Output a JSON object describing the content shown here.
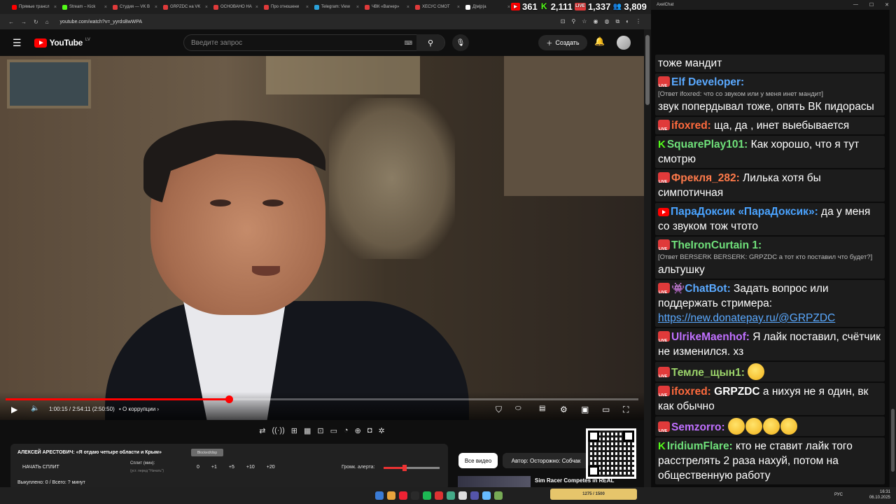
{
  "browser": {
    "tabs": [
      {
        "label": "Прямые трансл",
        "color": "#ff0000"
      },
      {
        "label": "Stream – Kick",
        "color": "#53fc18"
      },
      {
        "label": "Студия — VK В",
        "color": "#e03a3a"
      },
      {
        "label": "GRPZDC на VK",
        "color": "#e03a3a"
      },
      {
        "label": "ОСНОВАНО НА",
        "color": "#e03a3a"
      },
      {
        "label": "Про отношени",
        "color": "#e03a3a"
      },
      {
        "label": "Telegram: View",
        "color": "#2aa1da"
      },
      {
        "label": "ЧВК «Вагнер»",
        "color": "#e03a3a"
      },
      {
        "label": "ХЕСУС СМОТ",
        "color": "#e03a3a"
      },
      {
        "label": "Д|м|р|а",
        "color": "#ffffff"
      }
    ],
    "url": "youtube.com/watch?v=_yyrdsBwWPA"
  },
  "overlay": {
    "yt_count": "361",
    "kick_count": "2,111",
    "vk_count": "1,337",
    "total": "3,809"
  },
  "youtube": {
    "logo": "YouTube",
    "country": "LV",
    "search_placeholder": "Введите запрос",
    "create_label": "Создать",
    "player": {
      "current": "1:00:15",
      "duration": "2:54:11",
      "remaining": "(2:50:50)",
      "chapter": "О коррупции",
      "progress": 0.353
    },
    "panel": {
      "title": "АЛЕКСЕЙ АРЕСТОВИЧ: «Я отдаю четыре области и Крым»",
      "badge": "Blocked/disp",
      "start_split": "НАЧАТЬ СПЛИТ",
      "split_label": "Сплит (мин):",
      "split_sub": "(уст. перед \"Начать\")",
      "split_values": [
        "0",
        "+1",
        "+5",
        "+10",
        "+20"
      ],
      "alert_label": "Громк. алерта:",
      "alert_level": 0.38,
      "bought": "Выкуплено: 0 / Всего: ? минут"
    },
    "chips": [
      "Все видео",
      "Автор: Осторожно: Собчак"
    ],
    "rec_title": "Sim Racer Competes in REAL"
  },
  "chat_app": {
    "title": "AxelChat"
  },
  "chat": [
    {
      "badge": "none",
      "nick": "",
      "color": "#fff",
      "text": "тоже мандит"
    },
    {
      "badge": "live",
      "nick": "Elf Developer:",
      "color": "#5aa9ff",
      "reply": "[Ответ ifoxred: что со звуком или у меня инет мандит]",
      "text": "звук попердывал тоже, опять ВК пидорасы"
    },
    {
      "badge": "live",
      "nick": "ifoxred:",
      "color": "#ff6a3d",
      "text": "ща, да , инет выебывается"
    },
    {
      "badge": "kick",
      "nick": "SquarePlay101:",
      "color": "#6fe07a",
      "text": "Как хорошо, что я тут смотрю"
    },
    {
      "badge": "live",
      "nick": "Фрекля_282:",
      "color": "#ff7a4a",
      "text": "Лилька хотя бы симпотичная"
    },
    {
      "badge": "yt",
      "nick": "ПараДоксик «ПараДоксик»:",
      "color": "#4aa3ff",
      "text": "да у меня со звуком тож чтото"
    },
    {
      "badge": "live",
      "nick": "TheIronCurtain 1:",
      "color": "#6fe07a",
      "reply": "[Ответ BERSERK BERSERK: GRPZDC а тот кто поставил что будет?]",
      "text": "альтушку"
    },
    {
      "badge": "live",
      "nick": "👾ChatBot:",
      "color": "#5aa9ff",
      "text": "Задать вопрос или поддержать стримера:",
      "link": "https://new.donatepay.ru/@GRPZDC"
    },
    {
      "badge": "live",
      "nick": "UlrikeMaenhof:",
      "color": "#c070ff",
      "text": "Я лайк поставил, счётчик не изменился. хз"
    },
    {
      "badge": "live",
      "nick": "Темле_щын1:",
      "color": "#9bd36a",
      "text": "",
      "emojis": 1
    },
    {
      "badge": "live",
      "nick": "ifoxred:",
      "color": "#ff6a3d",
      "bold": "GRPZDC",
      "text": "а нихуя не я один, вк как обычно"
    },
    {
      "badge": "live",
      "nick": "Semzorro:",
      "color": "#c070ff",
      "text": "",
      "emojis": 4
    },
    {
      "badge": "kick",
      "nick": "IridiumFlare:",
      "color": "#6fe07a",
      "text": "кто не ставит лайк того расстрелять 2 раза нахуй, потом на общественную работу"
    }
  ],
  "taskbar": {
    "lang": "РУС",
    "time": "16:31",
    "date": "06.10.2025",
    "widget": "1275 / 1500"
  }
}
